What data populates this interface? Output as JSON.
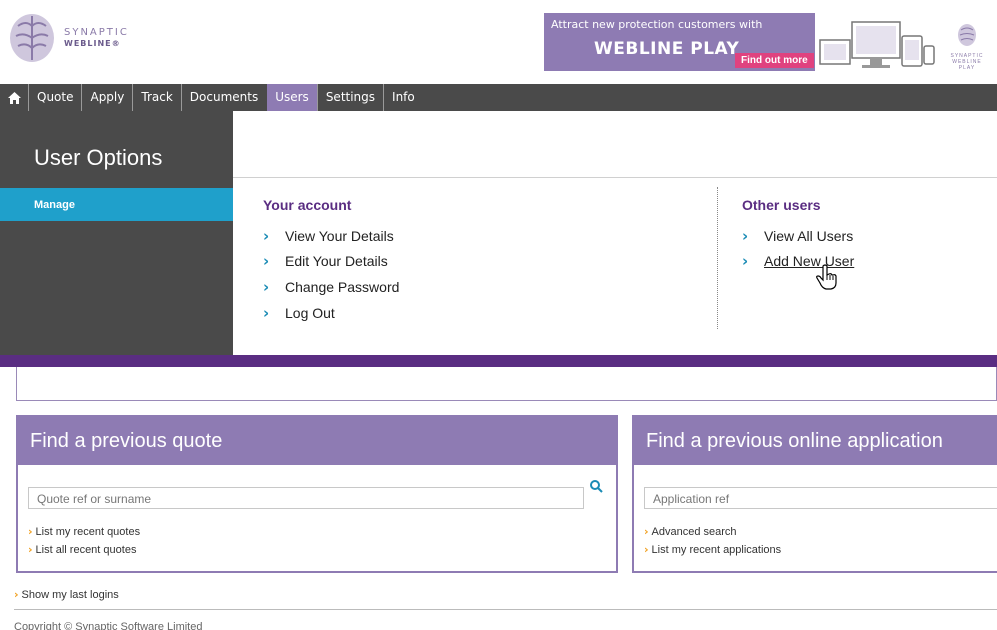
{
  "header": {
    "logo": {
      "line1": "SYNAPTIC",
      "line2": "WEBLINE®"
    },
    "banner": {
      "line1": "Attract new protection customers with",
      "line2": "WEBLINE PLAY",
      "cta": "Find out more"
    },
    "mini_logo": {
      "line1": "SYNAPTIC",
      "line2": "WEBLINE PLAY"
    }
  },
  "nav": {
    "items": [
      "Quote",
      "Apply",
      "Track",
      "Documents",
      "Users",
      "Settings",
      "Info"
    ],
    "active": "Users"
  },
  "user_options": {
    "title": "User Options",
    "sidebar_item": "Manage",
    "your_account": {
      "title": "Your account",
      "links": [
        "View Your Details",
        "Edit Your Details",
        "Change Password",
        "Log Out"
      ]
    },
    "other_users": {
      "title": "Other users",
      "links": [
        "View All Users",
        "Add New User"
      ]
    }
  },
  "quote_card": {
    "title": "Find a previous quote",
    "placeholder": "Quote ref or surname",
    "links": [
      "List my recent quotes",
      "List all recent quotes"
    ]
  },
  "application_card": {
    "title": "Find a previous online application",
    "placeholder": "Application ref",
    "links": [
      "Advanced search",
      "List my recent applications"
    ]
  },
  "show_last_logins": "Show my last logins",
  "copyright": "Copyright © Synaptic Software Limited",
  "colors": {
    "purple": "#5a2d82",
    "lilac": "#8e7bb3",
    "blue": "#1fa0cb",
    "nav": "#4a4a4a",
    "pink": "#e0427f"
  }
}
